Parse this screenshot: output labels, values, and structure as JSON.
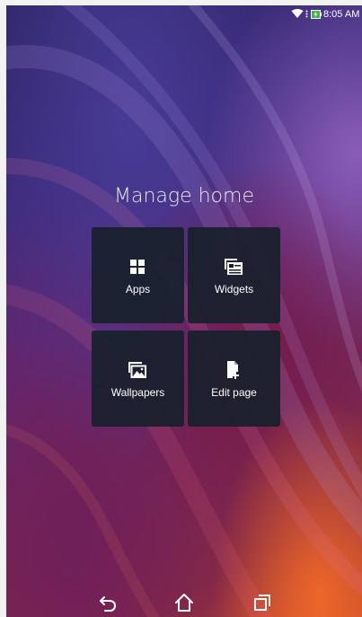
{
  "status_bar": {
    "time": "8:05 AM",
    "icons": [
      "wifi-icon",
      "overflow-dots-icon",
      "battery-charging-icon"
    ]
  },
  "manage_home": {
    "title": "Manage home",
    "tiles": [
      {
        "label": "Apps",
        "icon": "apps-grid-icon"
      },
      {
        "label": "Widgets",
        "icon": "widgets-icon"
      },
      {
        "label": "Wallpapers",
        "icon": "wallpaper-icon"
      },
      {
        "label": "Edit page",
        "icon": "edit-page-icon"
      }
    ]
  },
  "navigation_bar": {
    "buttons": [
      "back-icon",
      "home-icon",
      "recent-apps-icon"
    ]
  },
  "colors": {
    "tile_background": "#18202c",
    "text": "#ffffff",
    "title_text": "#e9e9ef",
    "battery_green": "#4caf50"
  }
}
